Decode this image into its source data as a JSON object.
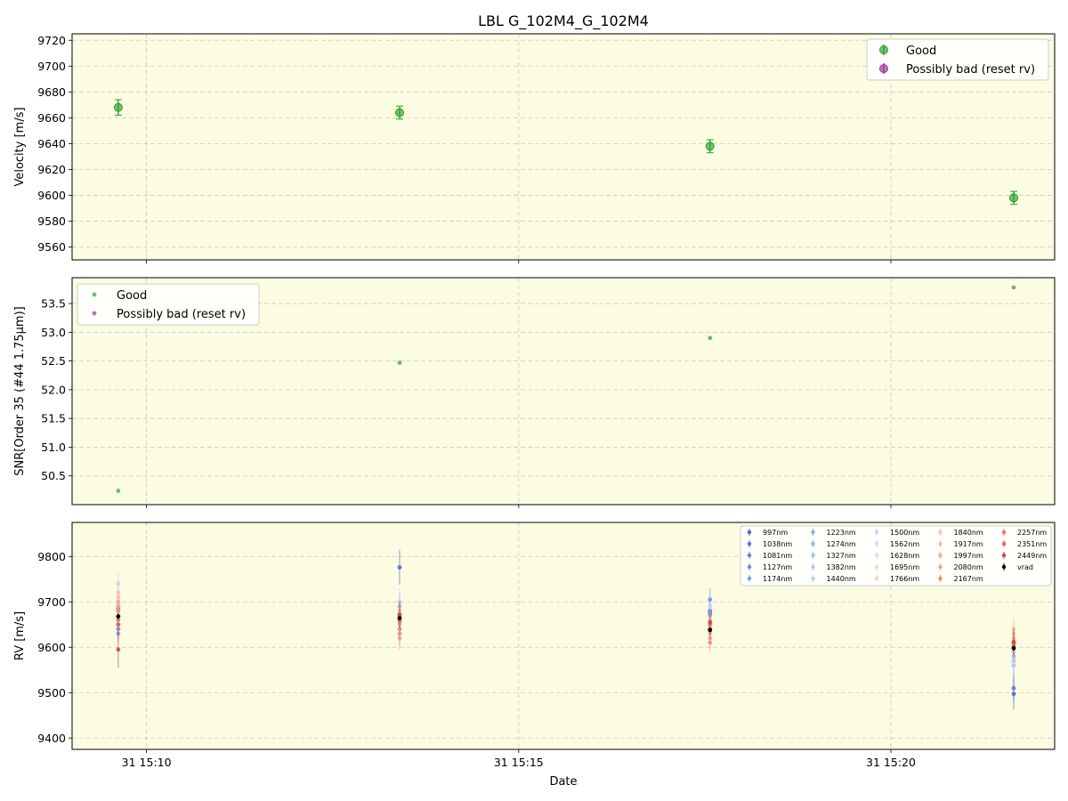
{
  "title": "LBL G_102M4_G_102M4",
  "xlabel": "Date",
  "x_ticks": [
    {
      "t": 10,
      "label": "31 15:10"
    },
    {
      "t": 15,
      "label": "31 15:15"
    },
    {
      "t": 20,
      "label": "31 15:20"
    }
  ],
  "colors": {
    "panel_bg": "#fcfce3",
    "good": "#2ca02c",
    "bad": "#9b2fa0",
    "vrad": "#000000",
    "grid": "#c8c8c8"
  },
  "chart_data": [
    {
      "type": "scatter",
      "panel": "velocity",
      "ylabel": "Velocity [m/s]",
      "ylim": [
        9550,
        9725
      ],
      "yticks": [
        9560,
        9580,
        9600,
        9620,
        9640,
        9660,
        9680,
        9700,
        9720
      ],
      "x_unit": "minutes after 15:00",
      "xlim": [
        9.0,
        22.2
      ],
      "grid": true,
      "legend_position": "top-right",
      "legend": [
        "Good",
        "Possibly bad (reset rv)"
      ],
      "series": [
        {
          "name": "Good",
          "x": [
            9.62,
            13.4,
            17.57,
            21.65
          ],
          "y": [
            9668,
            9664,
            9638,
            9598
          ],
          "err": [
            6,
            5,
            5,
            5
          ]
        },
        {
          "name": "Possibly bad (reset rv)",
          "x": [],
          "y": [],
          "err": []
        }
      ]
    },
    {
      "type": "scatter",
      "panel": "snr",
      "ylabel": "SNR[Order 35 (#44 1.75μm)]",
      "ylim": [
        50.0,
        53.95
      ],
      "yticks": [
        50.5,
        51.0,
        51.5,
        52.0,
        52.5,
        53.0,
        53.5
      ],
      "x_unit": "minutes after 15:00",
      "xlim": [
        9.0,
        22.2
      ],
      "grid": true,
      "legend_position": "top-left",
      "legend": [
        "Good",
        "Possibly bad (reset rv)"
      ],
      "series": [
        {
          "name": "Good",
          "x": [
            9.62,
            13.4,
            17.57,
            21.65
          ],
          "y": [
            50.24,
            52.47,
            52.9,
            53.78
          ]
        },
        {
          "name": "Possibly bad (reset rv)",
          "x": [],
          "y": []
        }
      ]
    },
    {
      "type": "scatter",
      "panel": "rv",
      "ylabel": "RV [m/s]",
      "ylim": [
        9375,
        9875
      ],
      "yticks": [
        9400,
        9500,
        9600,
        9700,
        9800
      ],
      "x_unit": "minutes after 15:00",
      "xlim": [
        9.0,
        22.2
      ],
      "x": [
        9.62,
        13.4,
        17.57,
        21.65
      ],
      "grid": true,
      "legend_position": "top-right",
      "legend_columns": 5,
      "series": [
        {
          "name": "997nm",
          "color": "#4a63d1",
          "y": [
            9686,
            9776,
            9680,
            9497
          ],
          "err": [
            25,
            38,
            30,
            35
          ]
        },
        {
          "name": "1038nm",
          "color": "#5672dc",
          "y": [
            9690,
            9670,
            9675,
            9510
          ],
          "err": [
            22,
            30,
            25,
            30
          ]
        },
        {
          "name": "1081nm",
          "color": "#627fe4",
          "y": [
            9650,
            9660,
            9705,
            9560
          ],
          "err": [
            22,
            30,
            25,
            30
          ]
        },
        {
          "name": "1127nm",
          "color": "#6f8cea",
          "y": [
            9640,
            9655,
            9680,
            9600
          ],
          "err": [
            22,
            28,
            25,
            28
          ]
        },
        {
          "name": "1174nm",
          "color": "#7b9af0",
          "y": [
            9630,
            9640,
            9670,
            9570
          ],
          "err": [
            20,
            28,
            22,
            28
          ]
        },
        {
          "name": "1223nm",
          "color": "#88a6f3",
          "y": [
            9690,
            9680,
            9660,
            9590
          ],
          "err": [
            20,
            28,
            22,
            26
          ]
        },
        {
          "name": "1274nm",
          "color": "#95b2f6",
          "y": [
            9700,
            9690,
            9650,
            9580
          ],
          "err": [
            20,
            26,
            22,
            26
          ]
        },
        {
          "name": "1327nm",
          "color": "#a2bcf7",
          "y": [
            9680,
            9670,
            9640,
            9600
          ],
          "err": [
            18,
            26,
            20,
            24
          ]
        },
        {
          "name": "1382nm",
          "color": "#b0c6f8",
          "y": [
            9720,
            9690,
            9650,
            9570
          ],
          "err": [
            26,
            30,
            26,
            30
          ]
        },
        {
          "name": "1440nm",
          "color": "#bdd0f8",
          "y": [
            9740,
            9700,
            9690,
            9560
          ],
          "err": [
            26,
            30,
            26,
            30
          ]
        },
        {
          "name": "1500nm",
          "color": "#c9d7f5",
          "y": [
            9700,
            9680,
            9660,
            9600
          ],
          "err": [
            20,
            26,
            22,
            26
          ]
        },
        {
          "name": "1562nm",
          "color": "#d3ddf2",
          "y": [
            9690,
            9670,
            9650,
            9590
          ],
          "err": [
            20,
            26,
            22,
            26
          ]
        },
        {
          "name": "1628nm",
          "color": "#dde0e8",
          "y": [
            9680,
            9660,
            9640,
            9600
          ],
          "err": [
            18,
            24,
            20,
            24
          ]
        },
        {
          "name": "1695nm",
          "color": "#e6dcd6",
          "y": [
            9690,
            9665,
            9645,
            9610
          ],
          "err": [
            18,
            24,
            20,
            24
          ]
        },
        {
          "name": "1766nm",
          "color": "#eed4c6",
          "y": [
            9700,
            9670,
            9650,
            9620
          ],
          "err": [
            18,
            24,
            20,
            24
          ]
        },
        {
          "name": "1840nm",
          "color": "#f2cab5",
          "y": [
            9720,
            9680,
            9655,
            9640
          ],
          "err": [
            20,
            26,
            22,
            26
          ]
        },
        {
          "name": "1917nm",
          "color": "#f4bea4",
          "y": [
            9710,
            9660,
            9640,
            9630
          ],
          "err": [
            20,
            26,
            22,
            26
          ]
        },
        {
          "name": "1997nm",
          "color": "#f3b093",
          "y": [
            9700,
            9650,
            9630,
            9620
          ],
          "err": [
            20,
            26,
            22,
            26
          ]
        },
        {
          "name": "2080nm",
          "color": "#f0a183",
          "y": [
            9690,
            9620,
            9620,
            9610
          ],
          "err": [
            20,
            26,
            22,
            26
          ]
        },
        {
          "name": "2167nm",
          "color": "#eb9072",
          "y": [
            9680,
            9630,
            9610,
            9600
          ],
          "err": [
            20,
            26,
            22,
            26
          ]
        },
        {
          "name": "2257nm",
          "color": "#e47d63",
          "y": [
            9660,
            9660,
            9650,
            9610
          ],
          "err": [
            22,
            28,
            24,
            28
          ]
        },
        {
          "name": "2351nm",
          "color": "#d96855",
          "y": [
            9650,
            9670,
            9640,
            9605
          ],
          "err": [
            22,
            28,
            24,
            28
          ]
        },
        {
          "name": "2449nm",
          "color": "#c94448",
          "y": [
            9595,
            9672,
            9655,
            9612
          ],
          "err": [
            40,
            30,
            26,
            30
          ]
        },
        {
          "name": "vrad",
          "color": "#000000",
          "y": [
            9668,
            9664,
            9638,
            9598
          ],
          "err": [
            6,
            5,
            5,
            5
          ]
        }
      ]
    }
  ]
}
